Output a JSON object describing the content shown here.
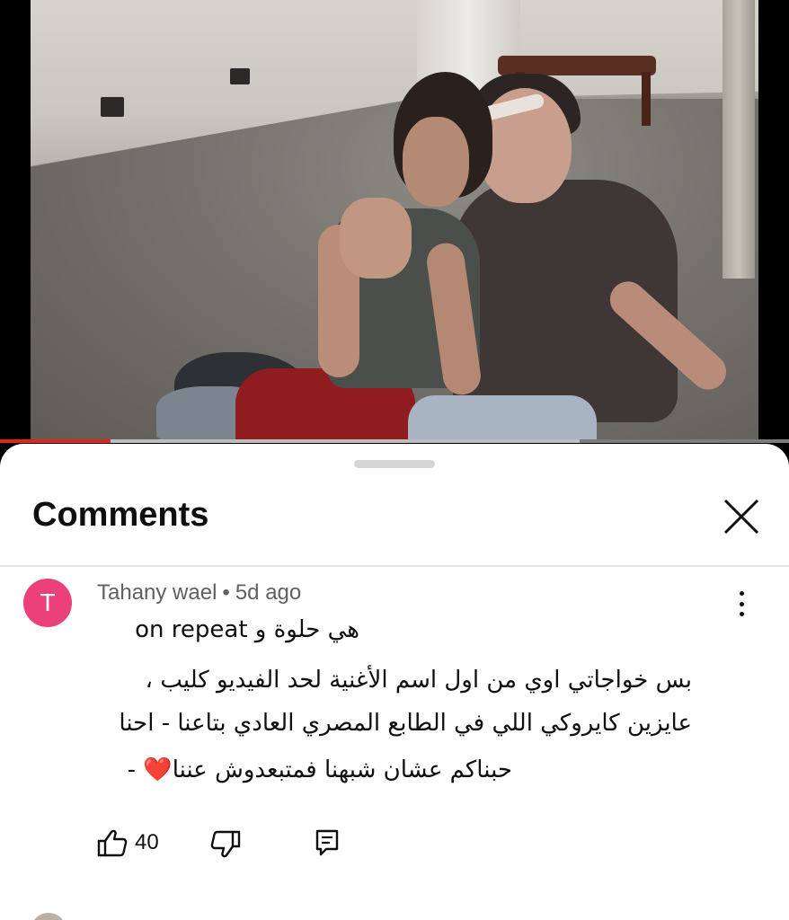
{
  "video": {
    "progress": 0.14,
    "buffered": 0.735,
    "progress_color": "#e1251b"
  },
  "sheet": {
    "title": "Comments",
    "close_icon": "close-icon"
  },
  "comment": {
    "avatar_letter": "T",
    "avatar_color": "#ec407a",
    "author": "Tahany wael",
    "separator": "•",
    "time": "5d ago",
    "lines": [
      "هي حلوة و  on repeat",
      "بس خواجاتي اوي من اول اسم الأغنية لحد الفيديو كليب ،",
      "عايزين كايروكي اللي في الطابع المصري العادي بتاعنا - احنا",
      "حبناكم عشان شبهنا فمتبعدوش عننا❤️ -"
    ],
    "likes": "40",
    "icons": {
      "like": "thumbs-up-icon",
      "dislike": "thumbs-down-icon",
      "reply": "reply-comment-icon",
      "more": "more-vertical-icon"
    }
  }
}
